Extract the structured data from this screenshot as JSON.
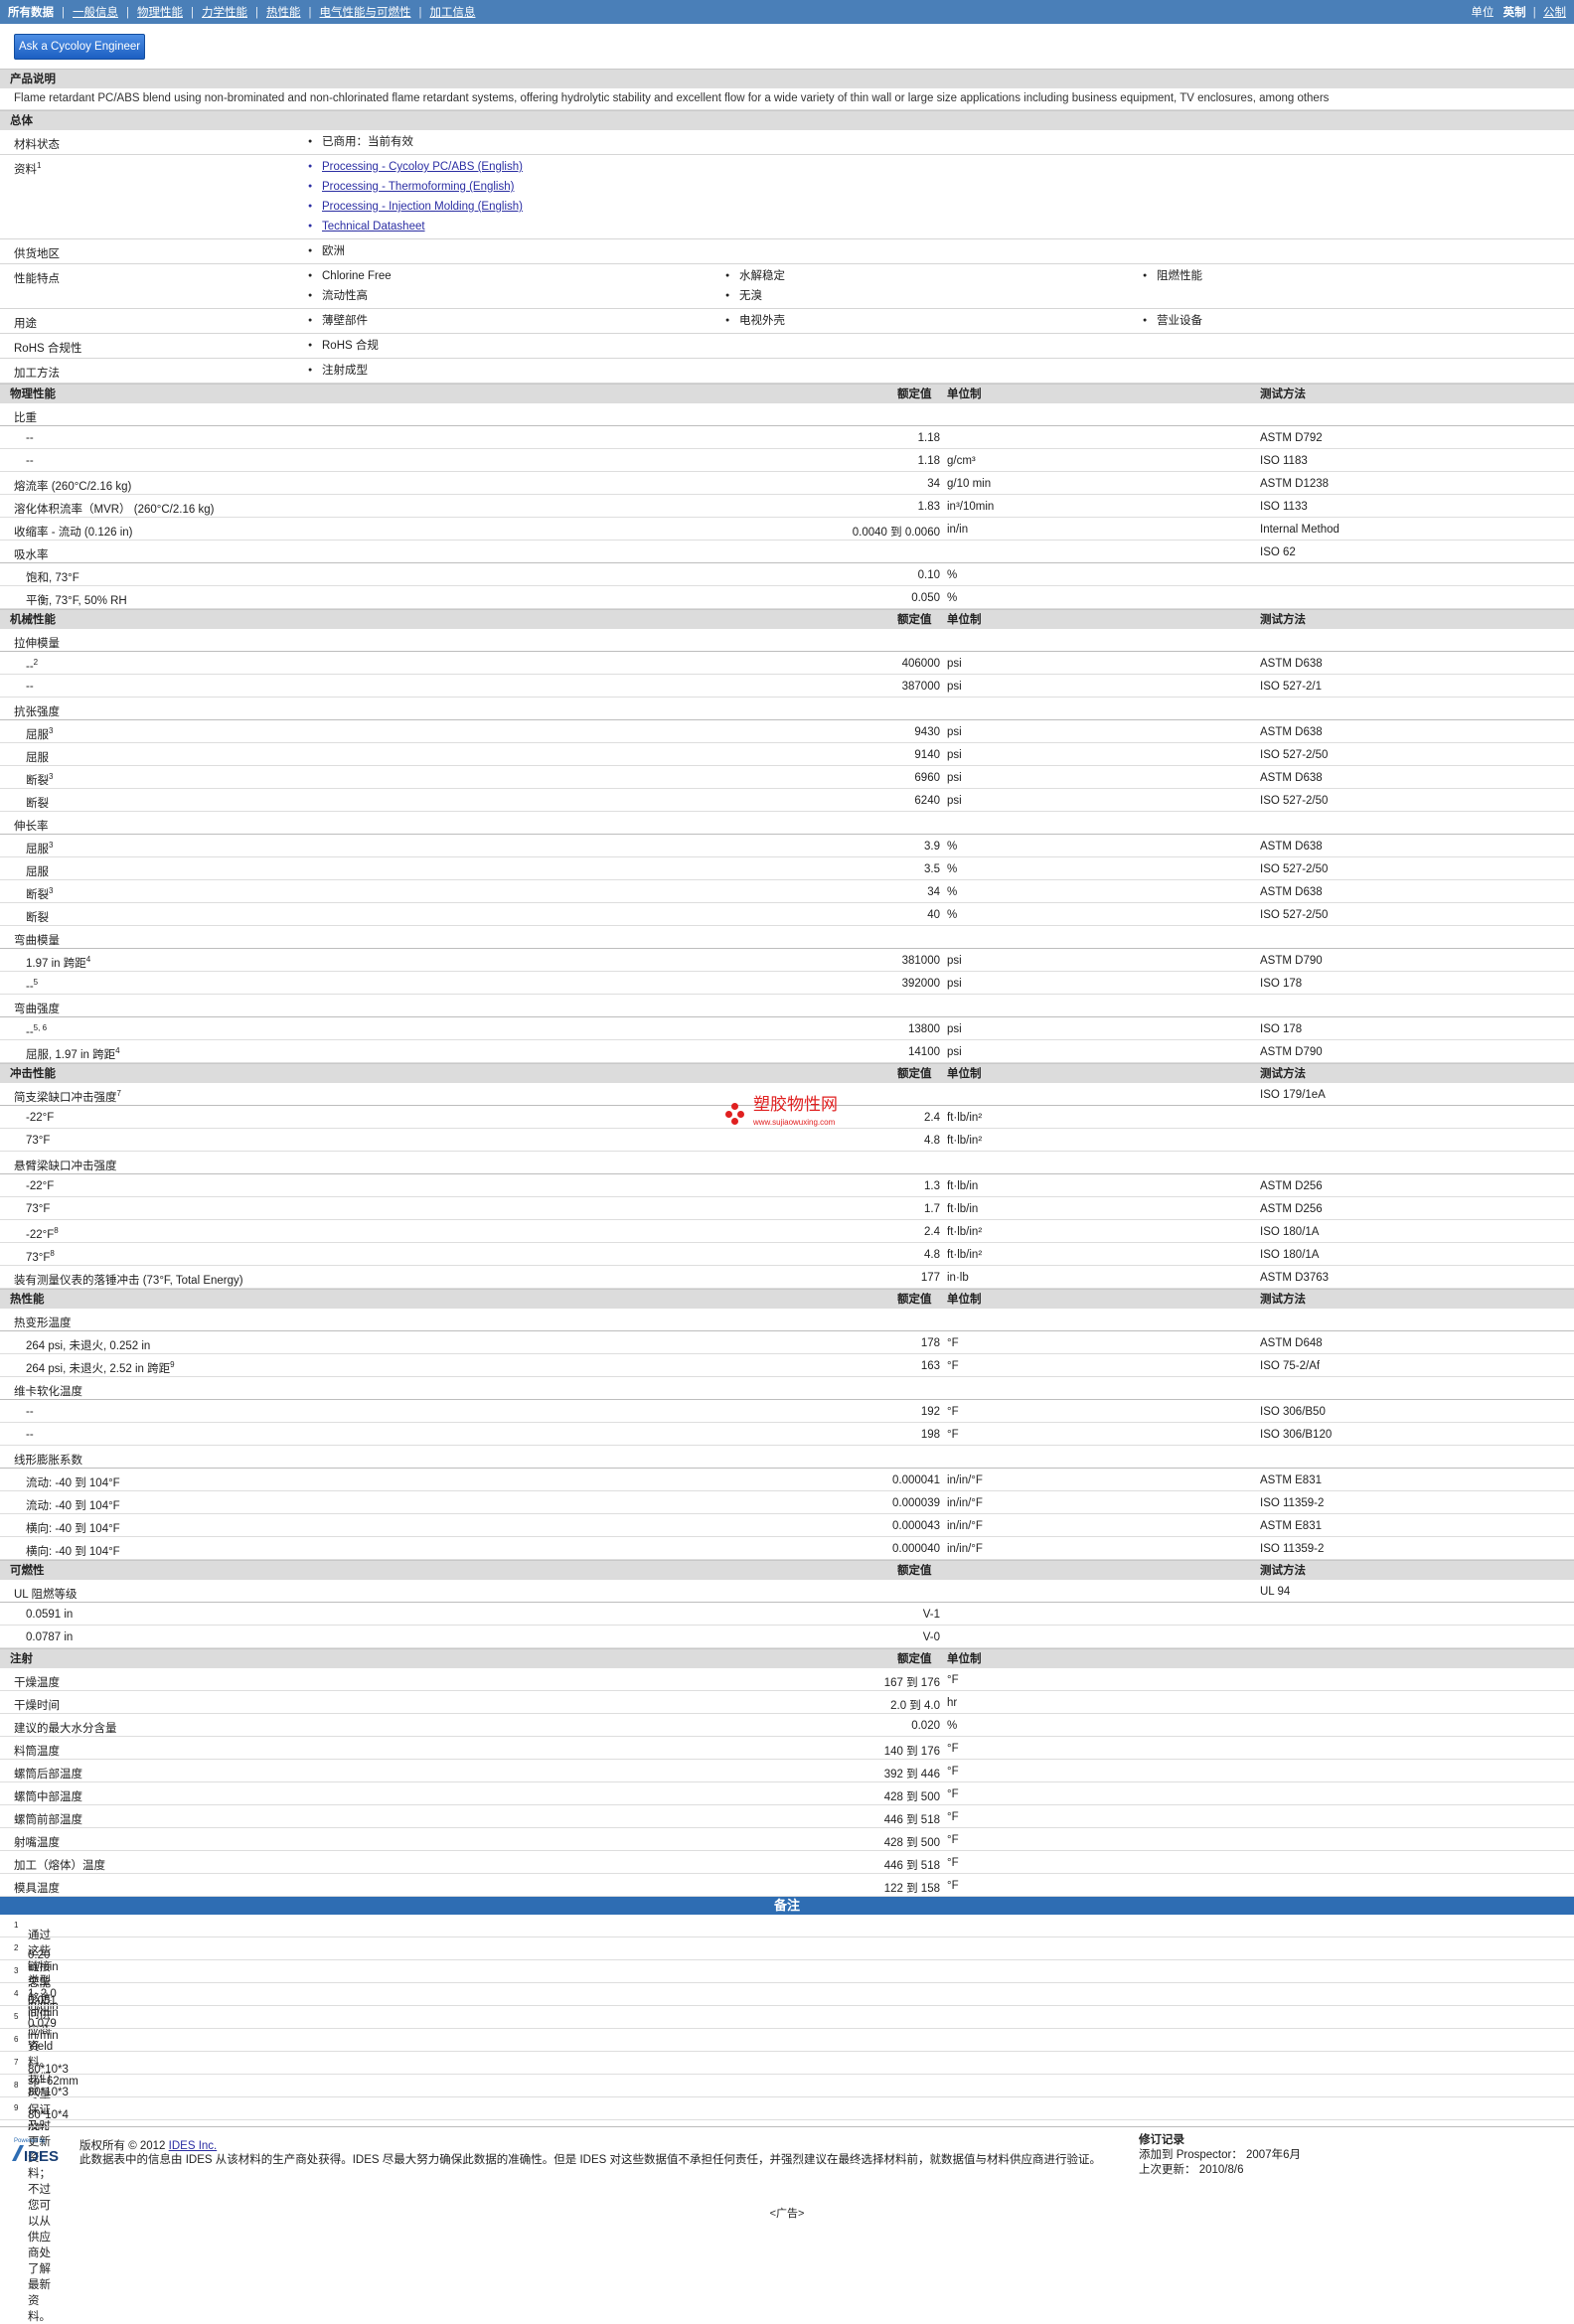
{
  "nav": {
    "items": [
      "所有数据",
      "一般信息",
      "物理性能",
      "力学性能",
      "热性能",
      "电气性能与可燃性",
      "加工信息"
    ],
    "units_label": "单位",
    "unit_english": "英制",
    "unit_metric": "公制"
  },
  "ask_button": "Ask a Cycoloy Engineer",
  "product": {
    "section": "产品说明",
    "description": "Flame retardant PC/ABS blend using non-brominated and non-chlorinated flame retardant systems, offering hydrolytic stability and excellent flow for a wide variety of thin wall or large size applications including business equipment, TV enclosures, among others"
  },
  "general": {
    "section": "总体",
    "rows": [
      {
        "label": "材料状态",
        "items": [
          "已商用：当前有效"
        ]
      },
      {
        "label": "资料",
        "sup": "1",
        "links": [
          "Processing - Cycoloy PC/ABS (English)",
          "Processing - Thermoforming (English)",
          "Processing - Injection Molding (English)",
          "Technical Datasheet"
        ]
      },
      {
        "label": "供货地区",
        "items": [
          "欧洲"
        ]
      },
      {
        "label": "性能特点",
        "items": [
          "Chlorine Free",
          "水解稳定",
          "阻燃性能",
          "流动性高",
          "无溴"
        ]
      },
      {
        "label": "用途",
        "items": [
          "薄壁部件",
          "电视外壳",
          "营业设备"
        ]
      },
      {
        "label": "RoHS 合规性",
        "items": [
          "RoHS 合规"
        ]
      },
      {
        "label": "加工方法",
        "items": [
          "注射成型"
        ]
      }
    ]
  },
  "headers": {
    "value": "额定值",
    "unit": "单位制",
    "method": "测试方法"
  },
  "physical": {
    "section": "物理性能",
    "rows": [
      {
        "l": "比重",
        "grp": true
      },
      {
        "l": "--",
        "ind": true,
        "v": "1.18",
        "m": "ASTM D792"
      },
      {
        "l": "--",
        "ind": true,
        "v": "1.18",
        "u": "g/cm³",
        "m": "ISO 1183"
      },
      {
        "l": "熔流率 (260°C/2.16 kg)",
        "v": "34",
        "u": "g/10 min",
        "m": "ASTM D1238"
      },
      {
        "l": "溶化体积流率（MVR） (260°C/2.16 kg)",
        "v": "1.83",
        "u": "in³/10min",
        "m": "ISO 1133"
      },
      {
        "l": "收缩率 - 流动 (0.126 in)",
        "v": "0.0040 到 0.0060",
        "u": "in/in",
        "m": "Internal Method"
      },
      {
        "l": "吸水率",
        "grp": true,
        "m": "ISO 62"
      },
      {
        "l": "饱和, 73°F",
        "ind": true,
        "v": "0.10",
        "u": "%"
      },
      {
        "l": "平衡, 73°F, 50% RH",
        "ind": true,
        "v": "0.050",
        "u": "%"
      }
    ]
  },
  "mechanical": {
    "section": "机械性能",
    "rows": [
      {
        "l": "拉伸模量",
        "grp": true
      },
      {
        "l": "--",
        "sup": "2",
        "ind": true,
        "v": "406000",
        "u": "psi",
        "m": "ASTM D638"
      },
      {
        "l": "--",
        "ind": true,
        "v": "387000",
        "u": "psi",
        "m": "ISO 527-2/1"
      },
      {
        "l": "抗张强度",
        "grp": true
      },
      {
        "l": "屈服",
        "sup": "3",
        "ind": true,
        "v": "9430",
        "u": "psi",
        "m": "ASTM D638"
      },
      {
        "l": "屈服",
        "ind": true,
        "v": "9140",
        "u": "psi",
        "m": "ISO 527-2/50"
      },
      {
        "l": "断裂",
        "sup": "3",
        "ind": true,
        "v": "6960",
        "u": "psi",
        "m": "ASTM D638"
      },
      {
        "l": "断裂",
        "ind": true,
        "v": "6240",
        "u": "psi",
        "m": "ISO 527-2/50"
      },
      {
        "l": "伸长率",
        "grp": true
      },
      {
        "l": "屈服",
        "sup": "3",
        "ind": true,
        "v": "3.9",
        "u": "%",
        "m": "ASTM D638"
      },
      {
        "l": "屈服",
        "ind": true,
        "v": "3.5",
        "u": "%",
        "m": "ISO 527-2/50"
      },
      {
        "l": "断裂",
        "sup": "3",
        "ind": true,
        "v": "34",
        "u": "%",
        "m": "ASTM D638"
      },
      {
        "l": "断裂",
        "ind": true,
        "v": "40",
        "u": "%",
        "m": "ISO 527-2/50"
      },
      {
        "l": "弯曲模量",
        "grp": true
      },
      {
        "l": "1.97 in 跨距",
        "sup": "4",
        "ind": true,
        "v": "381000",
        "u": "psi",
        "m": "ASTM D790"
      },
      {
        "l": "--",
        "sup": "5",
        "ind": true,
        "v": "392000",
        "u": "psi",
        "m": "ISO 178"
      },
      {
        "l": "弯曲强度",
        "grp": true
      },
      {
        "l": "--",
        "sup": "5, 6",
        "ind": true,
        "v": "13800",
        "u": "psi",
        "m": "ISO 178"
      },
      {
        "l": "屈服, 1.97 in 跨距",
        "sup": "4",
        "ind": true,
        "v": "14100",
        "u": "psi",
        "m": "ASTM D790"
      }
    ]
  },
  "impact": {
    "section": "冲击性能",
    "rows": [
      {
        "l": "简支梁缺口冲击强度",
        "sup": "7",
        "grp": true,
        "m": "ISO 179/1eA"
      },
      {
        "l": "-22°F",
        "ind": true,
        "v": "2.4",
        "u": "ft·lb/in²"
      },
      {
        "l": "73°F",
        "ind": true,
        "v": "4.8",
        "u": "ft·lb/in²"
      },
      {
        "l": "悬臂梁缺口冲击强度",
        "grp": true
      },
      {
        "l": "-22°F",
        "ind": true,
        "v": "1.3",
        "u": "ft·lb/in",
        "m": "ASTM D256"
      },
      {
        "l": "73°F",
        "ind": true,
        "v": "1.7",
        "u": "ft·lb/in",
        "m": "ASTM D256"
      },
      {
        "l": "-22°F",
        "sup": "8",
        "ind": true,
        "v": "2.4",
        "u": "ft·lb/in²",
        "m": "ISO 180/1A"
      },
      {
        "l": "73°F",
        "sup": "8",
        "ind": true,
        "v": "4.8",
        "u": "ft·lb/in²",
        "m": "ISO 180/1A"
      },
      {
        "l": "装有测量仪表的落锤冲击 (73°F, Total Energy)",
        "v": "177",
        "u": "in·lb",
        "m": "ASTM D3763"
      }
    ]
  },
  "thermal": {
    "section": "热性能",
    "rows": [
      {
        "l": "热变形温度",
        "grp": true
      },
      {
        "l": "264 psi, 未退火, 0.252 in",
        "ind": true,
        "v": "178",
        "u": "°F",
        "m": "ASTM D648"
      },
      {
        "l": "264 psi, 未退火, 2.52 in 跨距",
        "sup": "9",
        "ind": true,
        "v": "163",
        "u": "°F",
        "m": "ISO 75-2/Af"
      },
      {
        "l": "维卡软化温度",
        "grp": true
      },
      {
        "l": "--",
        "ind": true,
        "v": "192",
        "u": "°F",
        "m": "ISO 306/B50"
      },
      {
        "l": "--",
        "ind": true,
        "v": "198",
        "u": "°F",
        "m": "ISO 306/B120"
      },
      {
        "l": "线形膨胀系数",
        "grp": true
      },
      {
        "l": "流动: -40 到 104°F",
        "ind": true,
        "v": "0.000041",
        "u": "in/in/°F",
        "m": "ASTM E831"
      },
      {
        "l": "流动: -40 到 104°F",
        "ind": true,
        "v": "0.000039",
        "u": "in/in/°F",
        "m": "ISO 11359-2"
      },
      {
        "l": "横向: -40 到 104°F",
        "ind": true,
        "v": "0.000043",
        "u": "in/in/°F",
        "m": "ASTM E831"
      },
      {
        "l": "横向: -40 到 104°F",
        "ind": true,
        "v": "0.000040",
        "u": "in/in/°F",
        "m": "ISO 11359-2"
      }
    ]
  },
  "flammability": {
    "section": "可燃性",
    "rows": [
      {
        "l": "UL 阻燃等级",
        "grp": true,
        "m": "UL 94"
      },
      {
        "l": "0.0591 in",
        "ind": true,
        "v": "V-1"
      },
      {
        "l": "0.0787 in",
        "ind": true,
        "v": "V-0"
      }
    ]
  },
  "injection": {
    "section": "注射",
    "rows": [
      {
        "l": "干燥温度",
        "v": "167 到 176",
        "u": "°F"
      },
      {
        "l": "干燥时间",
        "v": "2.0 到 4.0",
        "u": "hr"
      },
      {
        "l": "建议的最大水分含量",
        "v": "0.020",
        "u": "%"
      },
      {
        "l": "料筒温度",
        "v": "140 到 176",
        "u": "°F"
      },
      {
        "l": "螺筒后部温度",
        "v": "392 到 446",
        "u": "°F"
      },
      {
        "l": "螺筒中部温度",
        "v": "428 到 500",
        "u": "°F"
      },
      {
        "l": "螺筒前部温度",
        "v": "446 到 518",
        "u": "°F"
      },
      {
        "l": "射嘴温度",
        "v": "428 到 500",
        "u": "°F"
      },
      {
        "l": "加工（熔体）温度",
        "v": "446 到 518",
        "u": "°F"
      },
      {
        "l": "模具温度",
        "v": "122 到 158",
        "u": "°F"
      }
    ]
  },
  "notes": {
    "title": "备注",
    "items": [
      {
        "n": "1",
        "t": "通过这些链接您能够访问供应商资料。我们尽量保证及时更新资料；不过您可以从供应商处了解最新资料。"
      },
      {
        "n": "2",
        "t": "0.20 in/min"
      },
      {
        "n": "3",
        "t": "类型 1, 2.0 in/min"
      },
      {
        "n": "4",
        "t": "0.051 in/min"
      },
      {
        "n": "5",
        "t": "0.079 in/min"
      },
      {
        "n": "6",
        "t": "Yield"
      },
      {
        "n": "7",
        "t": "80*10*3 sp=62mm"
      },
      {
        "n": "8",
        "t": "80*10*3"
      },
      {
        "n": "9",
        "t": "80*10*4 mm"
      }
    ]
  },
  "footer": {
    "powered": "Powered by",
    "logo": "IDES",
    "copyright": "版权所有 © 2012",
    "ides_link": "IDES Inc.",
    "disclaimer": "此数据表中的信息由 IDES 从该材料的生产商处获得。IDES 尽最大努力确保此数据的准确性。但是 IDES 对这些数据值不承担任何责任，并强烈建议在最终选择材料前，就数据值与材料供应商进行验证。",
    "rev_title": "修订记录",
    "added_label": "添加到 Prospector：",
    "added_value": "2007年6月",
    "updated_label": "上次更新：",
    "updated_value": "2010/8/6"
  },
  "watermark": {
    "text": "塑胶物性网",
    "sub": "www.sujiaowuxing.com"
  },
  "ad": "<广告>"
}
